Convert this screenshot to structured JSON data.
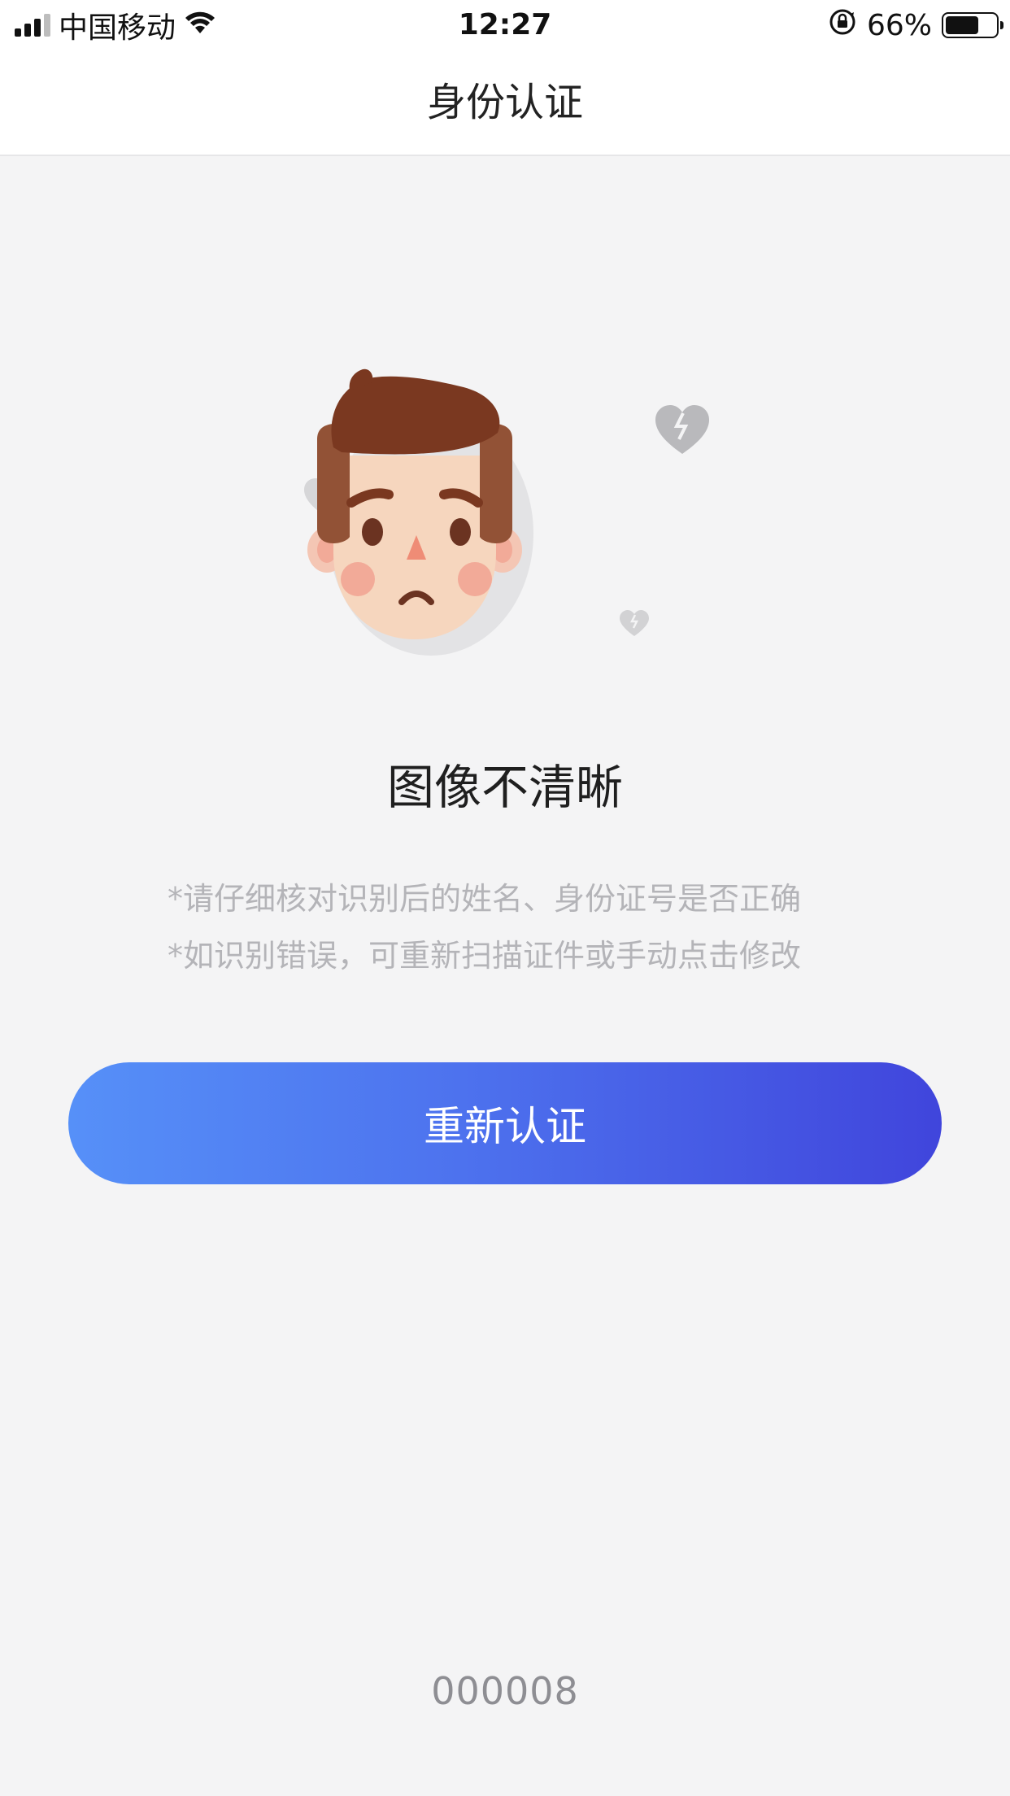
{
  "status_bar": {
    "carrier": "中国移动",
    "time": "12:27",
    "battery_percent": "66%",
    "battery_level": 0.66,
    "icons": [
      "signal-icon",
      "wifi-icon",
      "orientation-lock-icon",
      "battery-icon"
    ]
  },
  "nav": {
    "title": "身份认证"
  },
  "illustration": {
    "icon": "sad-face-broken-hearts-icon"
  },
  "main": {
    "title": "图像不清晰",
    "hints": [
      "*请仔细核对识别后的姓名、身份证号是否正确",
      "*如识别错误，可重新扫描证件或手动点击修改"
    ],
    "retry_label": "重新认证"
  },
  "footer": {
    "code": "000008"
  },
  "colors": {
    "button_gradient_start": "#5690f8",
    "button_gradient_end": "#4045dc",
    "background": "#f4f4f5",
    "hint_text": "#b4b4b8"
  }
}
